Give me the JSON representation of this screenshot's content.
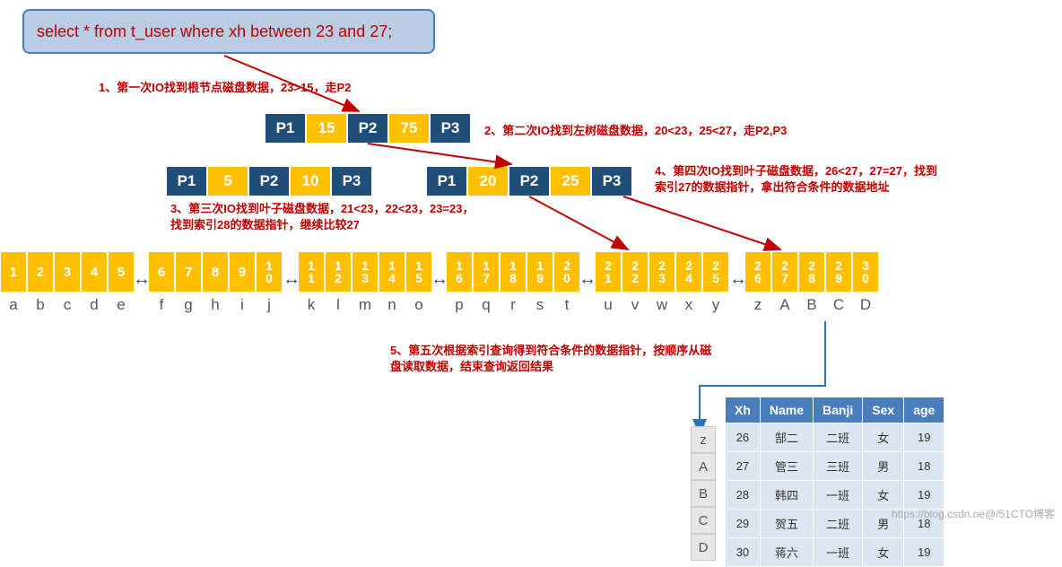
{
  "sql": "select * from t_user where xh between 23 and 27;",
  "annotations": {
    "a1": "1、第一次IO找到根节点磁盘数据，23>15，走P2",
    "a2": "2、第二次IO找到左树磁盘数据，20<23，25<27，走P2,P3",
    "a3_1": "3、第三次IO找到叶子磁盘数据，21<23，22<23，23=23，",
    "a3_2": "找到索引28的数据指针，继续比较27",
    "a4_1": "4、第四次IO找到叶子磁盘数据，26<27，27=27，找到",
    "a4_2": "索引27的数据指针，拿出符合条件的数据地址",
    "a5_1": "5、第五次根据索引查询得到符合条件的数据指针，按顺序从磁",
    "a5_2": "盘读取数据，结束查询返回结果"
  },
  "root": {
    "p1": "P1",
    "k1": "15",
    "p2": "P2",
    "k2": "75",
    "p3": "P3"
  },
  "left": {
    "p1": "P1",
    "k1": "5",
    "p2": "P2",
    "k2": "10",
    "p3": "P3"
  },
  "right": {
    "p1": "P1",
    "k1": "20",
    "p2": "P2",
    "k2": "25",
    "p3": "P3"
  },
  "leaves": [
    {
      "keys": [
        "1",
        "2",
        "3",
        "4",
        "5"
      ],
      "vals": [
        "a",
        "b",
        "c",
        "d",
        "e"
      ]
    },
    {
      "keys": [
        "6",
        "7",
        "8",
        "9",
        "10"
      ],
      "vals": [
        "f",
        "g",
        "h",
        "i",
        "j"
      ]
    },
    {
      "keys": [
        "11",
        "12",
        "13",
        "14",
        "15"
      ],
      "vals": [
        "k",
        "l",
        "m",
        "n",
        "o"
      ]
    },
    {
      "keys": [
        "16",
        "17",
        "18",
        "19",
        "20"
      ],
      "vals": [
        "p",
        "q",
        "r",
        "s",
        "t"
      ]
    },
    {
      "keys": [
        "21",
        "22",
        "23",
        "24",
        "25"
      ],
      "vals": [
        "u",
        "v",
        "w",
        "x",
        "y"
      ]
    },
    {
      "keys": [
        "26",
        "27",
        "28",
        "29",
        "30"
      ],
      "vals": [
        "z",
        "A",
        "B",
        "C",
        "D"
      ]
    }
  ],
  "table": {
    "headers": [
      "Xh",
      "Name",
      "Banji",
      "Sex",
      "age"
    ],
    "rowlabels": [
      "z",
      "A",
      "B",
      "C",
      "D"
    ],
    "rows": [
      [
        "26",
        "郜二",
        "二班",
        "女",
        "19"
      ],
      [
        "27",
        "管三",
        "三班",
        "男",
        "18"
      ],
      [
        "28",
        "韩四",
        "一班",
        "女",
        "19"
      ],
      [
        "29",
        "贺五",
        "二班",
        "男",
        "18"
      ],
      [
        "30",
        "蒋六",
        "一班",
        "女",
        "19"
      ]
    ]
  },
  "watermark": "https://blog.csdn.ne@/51CTO博客",
  "chart_data": {
    "type": "table",
    "description": "B+Tree index range query visualization for SQL BETWEEN 23 AND 27",
    "tree": {
      "root": {
        "pointers": [
          "P1",
          "P2",
          "P3"
        ],
        "keys": [
          15,
          75
        ]
      },
      "level2_left": {
        "pointers": [
          "P1",
          "P2",
          "P3"
        ],
        "keys": [
          5,
          10
        ]
      },
      "level2_right": {
        "pointers": [
          "P1",
          "P2",
          "P3"
        ],
        "keys": [
          20,
          25
        ]
      },
      "leaf_blocks": [
        {
          "keys": [
            1,
            2,
            3,
            4,
            5
          ],
          "ptrs": [
            "a",
            "b",
            "c",
            "d",
            "e"
          ]
        },
        {
          "keys": [
            6,
            7,
            8,
            9,
            10
          ],
          "ptrs": [
            "f",
            "g",
            "h",
            "i",
            "j"
          ]
        },
        {
          "keys": [
            11,
            12,
            13,
            14,
            15
          ],
          "ptrs": [
            "k",
            "l",
            "m",
            "n",
            "o"
          ]
        },
        {
          "keys": [
            16,
            17,
            18,
            19,
            20
          ],
          "ptrs": [
            "p",
            "q",
            "r",
            "s",
            "t"
          ]
        },
        {
          "keys": [
            21,
            22,
            23,
            24,
            25
          ],
          "ptrs": [
            "u",
            "v",
            "w",
            "x",
            "y"
          ]
        },
        {
          "keys": [
            26,
            27,
            28,
            29,
            30
          ],
          "ptrs": [
            "z",
            "A",
            "B",
            "C",
            "D"
          ]
        }
      ]
    },
    "result_table": {
      "columns": [
        "Xh",
        "Name",
        "Banji",
        "Sex",
        "age"
      ],
      "rows": [
        [
          26,
          "郜二",
          "二班",
          "女",
          19
        ],
        [
          27,
          "管三",
          "三班",
          "男",
          18
        ],
        [
          28,
          "韩四",
          "一班",
          "女",
          19
        ],
        [
          29,
          "贺五",
          "二班",
          "男",
          18
        ],
        [
          30,
          "蒋六",
          "一班",
          "女",
          19
        ]
      ]
    }
  }
}
